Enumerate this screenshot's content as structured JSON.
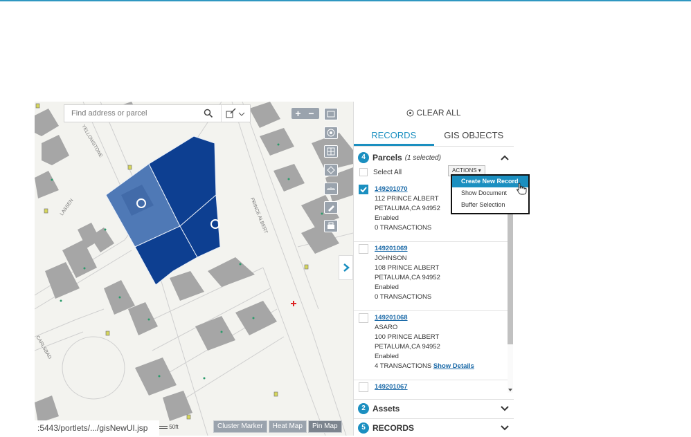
{
  "colors": {
    "accent": "#1b8fc0",
    "parcel_dark": "#0d3f91",
    "parcel_light": "#4f79b6",
    "building": "#a6a6a6"
  },
  "map": {
    "search": {
      "placeholder": "Find address or parcel",
      "icon": "search-icon",
      "draw_icon": "draw-select-icon"
    },
    "zoom": {
      "in": "+",
      "out": "−"
    },
    "tool_icons": [
      "basemap-icon",
      "locate-icon",
      "grid-icon",
      "layers-icon",
      "measure-icon",
      "edit-icon",
      "print-icon"
    ],
    "street_labels": [
      "YELLOWSTONE",
      "LASSEN",
      "PRINCE ALBERT",
      "CARLSBAD"
    ],
    "url": ":5443/portlets/.../gisNewUI.jsp",
    "scale": "50ft",
    "layer_buttons": [
      "Cluster Marker",
      "Heat Map",
      "Pin Map"
    ]
  },
  "panel": {
    "clear_all": "CLEAR ALL",
    "tabs": [
      "RECORDS",
      "GIS OBJECTS"
    ],
    "parcels": {
      "count": "4",
      "label": "Parcels",
      "selected": "(1 selected)"
    },
    "select_all": "Select All",
    "actions": {
      "label": "ACTIONS",
      "items": [
        "Create New Record",
        "Show Document",
        "Buffer Selection"
      ]
    },
    "records": [
      {
        "id": "149201070",
        "lines": [
          "112 PRINCE ALBERT",
          "PETALUMA,CA 94952",
          "Enabled",
          "0 TRANSACTIONS"
        ],
        "checked": true
      },
      {
        "id": "149201069",
        "lines": [
          "JOHNSON",
          "108 PRINCE ALBERT",
          "PETALUMA,CA 94952",
          "Enabled",
          "0 TRANSACTIONS"
        ],
        "checked": false
      },
      {
        "id": "149201068",
        "lines": [
          "ASARO",
          "100 PRINCE ALBERT",
          "PETALUMA,CA 94952",
          "Enabled",
          "4 TRANSACTIONS"
        ],
        "detail_link": "Show Details",
        "checked": false
      },
      {
        "id": "149201067",
        "lines": [],
        "checked": false
      }
    ],
    "assets": {
      "count": "2",
      "label": "Assets"
    },
    "records_section": {
      "count": "5",
      "label": "RECORDS"
    }
  }
}
